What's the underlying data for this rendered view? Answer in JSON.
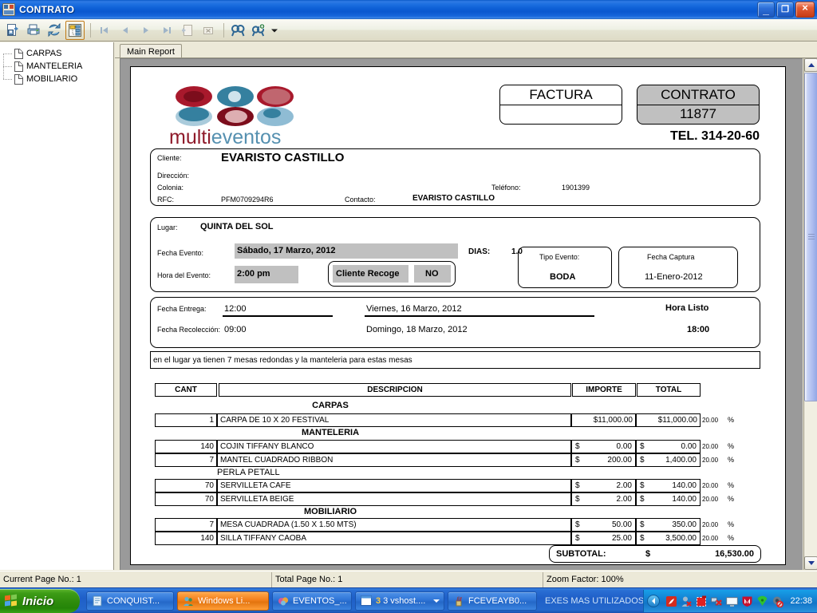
{
  "window": {
    "title": "CONTRATO",
    "icon": "report-window-icon",
    "buttons": {
      "minimize": "_",
      "maximize": "❐",
      "close": "×"
    }
  },
  "toolbar": {
    "items": [
      {
        "name": "export-icon",
        "tip": "Export"
      },
      {
        "name": "print-icon",
        "tip": "Print"
      },
      {
        "name": "refresh-icon",
        "tip": "Refresh"
      },
      {
        "name": "toggle-group-tree-icon",
        "tip": "Toggle Group Tree",
        "active": true
      },
      {
        "name": "first-page-icon",
        "tip": "Go To First Page"
      },
      {
        "name": "previous-page-icon",
        "tip": "Go To Previous Page"
      },
      {
        "name": "next-page-icon",
        "tip": "Go To Next Page"
      },
      {
        "name": "last-page-icon",
        "tip": "Go To Last Page"
      },
      {
        "name": "go-to-page-icon",
        "tip": "Go To Page"
      },
      {
        "name": "stop-icon",
        "tip": "Stop Loading"
      },
      {
        "name": "search-icon",
        "tip": "Find Text"
      },
      {
        "name": "zoom-icon",
        "tip": "Zoom"
      },
      {
        "name": "zoom-dropdown-icon",
        "tip": "Zoom options"
      }
    ]
  },
  "tree": {
    "items": [
      {
        "label": "CARPAS",
        "icon": "page-icon"
      },
      {
        "label": "MANTELERIA",
        "icon": "page-icon"
      },
      {
        "label": "MOBILIARIO",
        "icon": "page-icon"
      }
    ]
  },
  "tabs": [
    {
      "label": "Main Report",
      "selected": true
    }
  ],
  "report": {
    "logo": {
      "word_part1": "multi",
      "word_part2": "eventos",
      "color_dark_red": "#8f1b2b",
      "color_blue": "#3f7fa3",
      "color_light_blue": "#8fbcd4",
      "color_pink": "#d9a3a6"
    },
    "factura_box": {
      "title": "FACTURA",
      "value": ""
    },
    "contrato_box": {
      "title": "CONTRATO",
      "value": "11877",
      "bg": "#c0c0c0"
    },
    "telephone": "TEL. 314-20-60",
    "client": {
      "cliente_label": "Cliente:",
      "cliente_value": "EVARISTO CASTILLO",
      "direccion_label": "Dirección:",
      "direccion_value": "",
      "colonia_label": "Colonia:",
      "colonia_value": "",
      "telefono_label": "Teléfono:",
      "telefono_value": "1901399",
      "rfc_label": "RFC:",
      "rfc_value": "PFM0709294R6",
      "contacto_label": "Contacto:",
      "contacto_value": "EVARISTO CASTILLO"
    },
    "event": {
      "lugar_label": "Lugar:",
      "lugar_value": "QUINTA DEL SOL",
      "fecha_evento_label": "Fecha Evento:",
      "fecha_evento_value": "Sábado, 17 Marzo, 2012",
      "dias_label": "DIAS:",
      "dias_value": "1.0",
      "hora_evento_label": "Hora del Evento:",
      "hora_evento_value": "2:00 pm",
      "cliente_recoge_label": "Cliente Recoge",
      "cliente_recoge_value": "NO",
      "tipo_evento_label": "Tipo Evento:",
      "tipo_evento_value": "BODA",
      "fecha_captura_label": "Fecha Captura",
      "fecha_captura_value": "11-Enero-2012"
    },
    "delivery": {
      "entrega_label": "Fecha Entrega:",
      "entrega_time": "12:00",
      "entrega_date": "Viernes, 16 Marzo, 2012",
      "hora_listo_label": "Hora Listo",
      "recoleccion_label": "Fecha Recolección:",
      "recoleccion_time": "09:00",
      "recoleccion_date": "Domingo, 18 Marzo, 2012",
      "hora_listo_value": "18:00"
    },
    "note": "en el lugar ya tienen 7 mesas redondas y la manteleria para estas mesas",
    "table": {
      "headers": [
        "CANT",
        "DESCRIPCION",
        "IMPORTE",
        "TOTAL"
      ],
      "groups": [
        {
          "title": "CARPAS",
          "rows": [
            {
              "cant": "1",
              "descripcion": "CARPA DE 10 X 20 FESTIVAL",
              "importe": "$11,000.00",
              "total": "$11,000.00",
              "pct": "20.00",
              "pct_symbol": "%"
            }
          ]
        },
        {
          "title": "MANTELERIA",
          "rows": [
            {
              "cant": "140",
              "descripcion": "COJIN TIFFANY BLANCO",
              "importe_sym": "$",
              "importe": "0.00",
              "total_sym": "$",
              "total": "0.00",
              "pct": "20.00",
              "pct_symbol": "%"
            },
            {
              "cant": "7",
              "descripcion": "MANTEL CUADRADO RIBBON",
              "importe_sym": "$",
              "importe": "200.00",
              "total_sym": "$",
              "total": "1,400.00",
              "pct": "20.00",
              "pct_symbol": "%"
            }
          ]
        },
        {
          "title": "PERLA PETALL",
          "subgroup": true,
          "rows": [
            {
              "cant": "70",
              "descripcion": "SERVILLETA CAFE",
              "importe_sym": "$",
              "importe": "2.00",
              "total_sym": "$",
              "total": "140.00",
              "pct": "20.00",
              "pct_symbol": "%"
            },
            {
              "cant": "70",
              "descripcion": "SERVILLETA BEIGE",
              "importe_sym": "$",
              "importe": "2.00",
              "total_sym": "$",
              "total": "140.00",
              "pct": "20.00",
              "pct_symbol": "%"
            }
          ]
        },
        {
          "title": "MOBILIARIO",
          "rows": [
            {
              "cant": "7",
              "descripcion": "MESA CUADRADA (1.50 X 1.50 MTS)",
              "importe_sym": "$",
              "importe": "50.00",
              "total_sym": "$",
              "total": "350.00",
              "pct": "20.00",
              "pct_symbol": "%"
            },
            {
              "cant": "140",
              "descripcion": "SILLA TIFFANY  CAOBA",
              "importe_sym": "$",
              "importe": "25.00",
              "total_sym": "$",
              "total": "3,500.00",
              "pct": "20.00",
              "pct_symbol": "%"
            }
          ]
        }
      ],
      "subtotal_label": "SUBTOTAL:",
      "subtotal_symbol": "$",
      "subtotal_value": "16,530.00"
    }
  },
  "statusbar": {
    "current_page": "Current Page No.: 1",
    "total_page": "Total Page No.: 1",
    "zoom_factor": "Zoom Factor: 100%"
  },
  "taskbar": {
    "start_label": "Inicio",
    "buttons": [
      {
        "label": "CONQUIST...",
        "icon": "notepad-icon",
        "active": false
      },
      {
        "label": "Windows Li...",
        "icon": "messenger-icon",
        "active": true
      },
      {
        "label": "EVENTOS_...",
        "icon": "visualstudio-icon",
        "active": false
      },
      {
        "label": "3 vshost....",
        "icon": "window-group-icon",
        "active": false,
        "count": "3",
        "dropdown": true
      },
      {
        "label": "FCEVEAYB0...",
        "icon": "paint-icon",
        "active": false
      }
    ],
    "group_label": "EXES MAS UTILIZADOS",
    "overflow_glyph": "»",
    "clock": "22:38",
    "tray_icons": [
      "show-hidden-icons-chevron",
      "acrobat-icon",
      "user-error-icon",
      "recording-icon",
      "network-disconnected-icon",
      "display-icon",
      "mcafee-icon",
      "wireless-icon",
      "volume-muted-icon"
    ]
  },
  "scrollbar": {
    "name": "vertical-scrollbar",
    "thumb_top_pct": 3,
    "thumb_height_pct": 64
  }
}
